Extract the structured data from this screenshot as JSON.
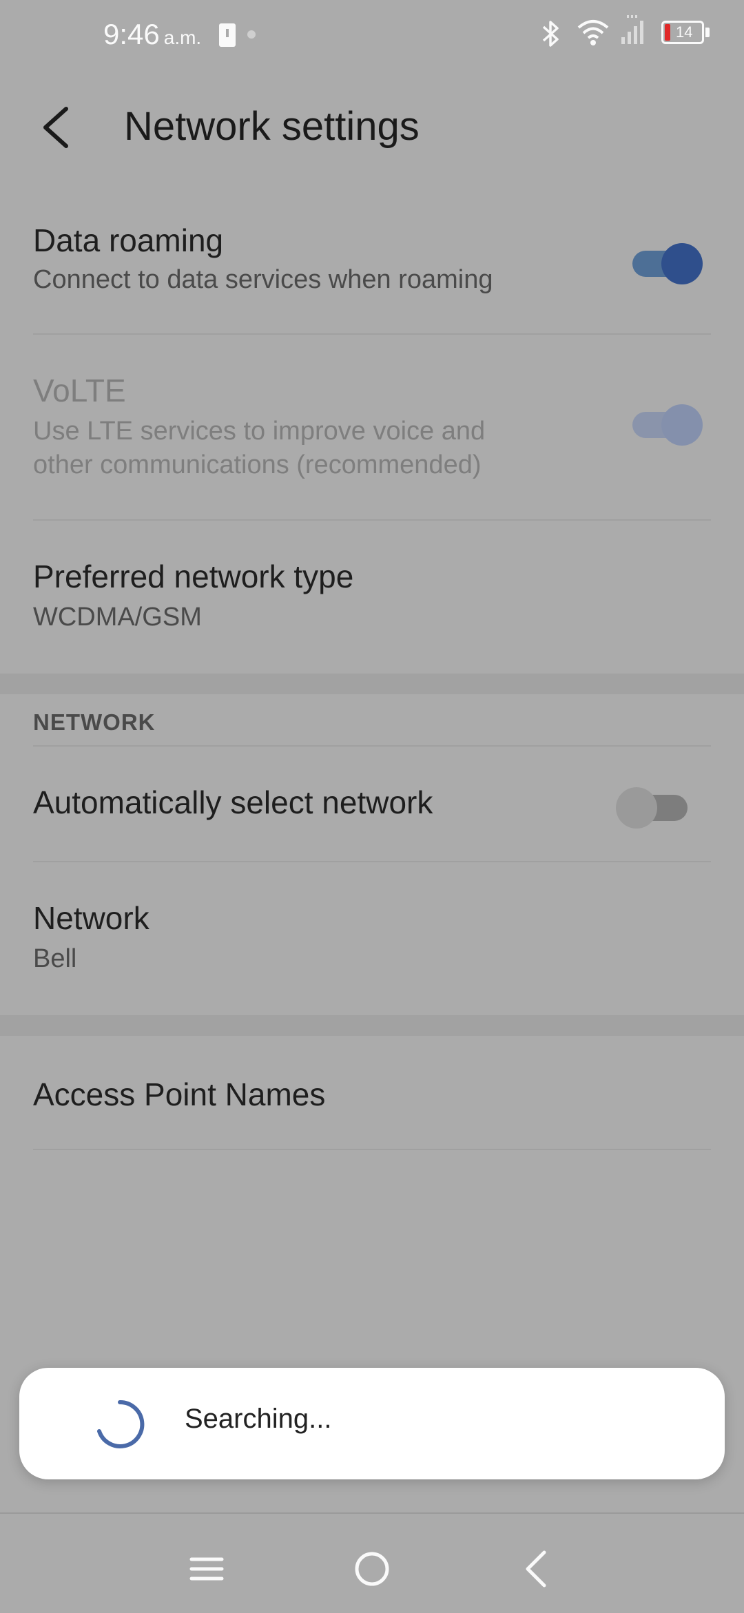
{
  "status_bar": {
    "time": "9:46",
    "ampm": "a.m.",
    "battery_level": "14",
    "icons": [
      "alert-icon",
      "bluetooth-icon",
      "wifi-icon",
      "signal-icon",
      "battery-icon"
    ]
  },
  "header": {
    "title": "Network settings"
  },
  "settings": {
    "data_roaming": {
      "title": "Data roaming",
      "subtitle": "Connect to data services when roaming",
      "enabled": true
    },
    "volte": {
      "title": "VoLTE",
      "subtitle_line1": "Use LTE services to improve voice and",
      "subtitle_line2": "other communications (recommended)",
      "enabled": true,
      "disabled": true
    },
    "preferred_network_type": {
      "title": "Preferred network type",
      "value": "WCDMA/GSM"
    },
    "network_section": {
      "header": "NETWORK"
    },
    "auto_select": {
      "title": "Automatically select network",
      "enabled": false
    },
    "network": {
      "title": "Network",
      "value": "Bell"
    },
    "apn": {
      "title": "Access Point Names"
    }
  },
  "toast": {
    "text": "Searching..."
  },
  "colors": {
    "accent": "#2f4f8c",
    "background": "#ababab",
    "dialog": "#ffffff"
  }
}
